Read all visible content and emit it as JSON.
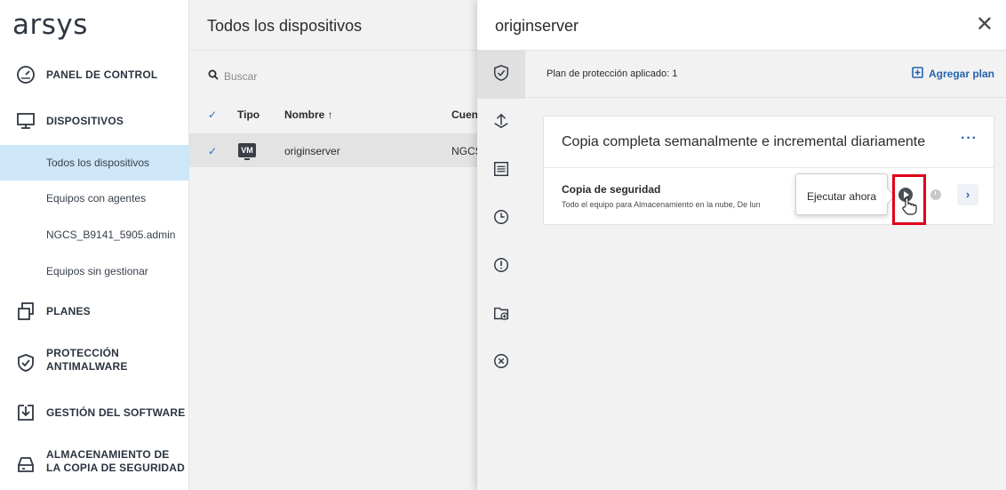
{
  "app": {
    "logo": "arsys"
  },
  "sidebar": {
    "items": [
      {
        "label": "PANEL DE CONTROL",
        "icon": "speedometer-icon"
      },
      {
        "label": "DISPOSITIVOS",
        "icon": "monitor-icon"
      },
      {
        "label": "PLANES",
        "icon": "plans-icon"
      },
      {
        "label": "PROTECCIÓN ANTIMALWARE",
        "line1": "PROTECCIÓN",
        "line2": "ANTIMALWARE",
        "icon": "shield-check-icon"
      },
      {
        "label": "GESTIÓN DEL SOFTWARE",
        "icon": "software-update-icon"
      },
      {
        "label": "ALMACENAMIENTO DE LA COPIA DE SEGURIDAD",
        "line1": "ALMACENAMIENTO DE",
        "line2": "LA COPIA DE SEGURIDAD",
        "icon": "storage-icon"
      }
    ],
    "subitems": [
      {
        "label": "Todos los dispositivos",
        "active": true
      },
      {
        "label": "Equipos con agentes"
      },
      {
        "label": "NGCS_B9141_5905.admin"
      },
      {
        "label": "Equipos sin gestionar"
      }
    ]
  },
  "devices": {
    "title": "Todos los dispositivos",
    "search_placeholder": "Buscar",
    "columns": {
      "type": "Tipo",
      "name": "Nombre ↑",
      "account": "Cuen"
    },
    "rows": [
      {
        "type": "VM",
        "name": "originserver",
        "account": "NGCS"
      }
    ]
  },
  "panel": {
    "title": "originserver",
    "plan_applied": "Plan de protección aplicado: 1",
    "add_plan": "Agregar plan",
    "plan": {
      "title": "Copia completa semanalmente e incremental diariamente",
      "more": "···",
      "backup_title": "Copia de seguridad",
      "backup_desc": "Todo el equipo para Almacenamiento en la nube, De lun"
    },
    "tooltip": "Ejecutar ahora",
    "rail_icons": [
      "shield-check-icon",
      "recovery-icon",
      "activity-list-icon",
      "clock-icon",
      "alert-icon",
      "folder-add-icon",
      "delete-icon"
    ]
  },
  "colors": {
    "accent": "#2463ad",
    "highlight": "#e0001a",
    "selected": "#cde6f8"
  }
}
